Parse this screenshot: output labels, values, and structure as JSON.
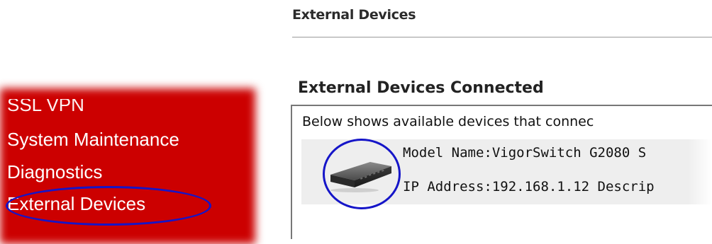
{
  "page": {
    "title": "External Devices"
  },
  "menu": {
    "items": [
      {
        "label": "SSL VPN"
      },
      {
        "label": "System Maintenance"
      },
      {
        "label": "Diagnostics"
      },
      {
        "label": "External Devices",
        "selected": true
      }
    ]
  },
  "section": {
    "heading": "External Devices Connected",
    "description": "Below shows available devices that connec",
    "devices": [
      {
        "model_line": "Model Name:VigorSwitch G2080 S",
        "ip_line": "IP Address:192.168.1.12 Descrip",
        "image_icon": "network-switch-icon"
      }
    ]
  },
  "colors": {
    "menu_bg": "#cc0000",
    "highlight_circle": "#1515c8",
    "row_bg": "#eeeeee"
  }
}
